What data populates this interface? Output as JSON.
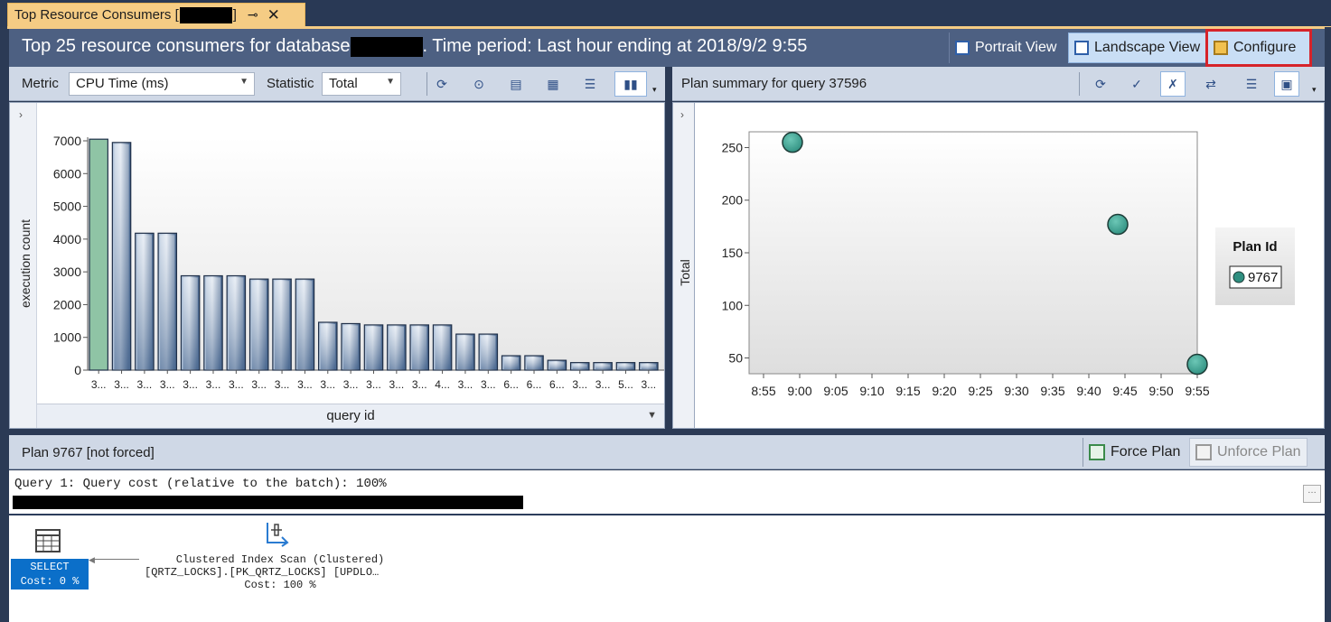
{
  "tab": {
    "title_prefix": "Top Resource Consumers [",
    "title_suffix": "]",
    "pin_glyph": "⊸",
    "close_glyph": "✕"
  },
  "header": {
    "title_prefix": "Top 25 resource consumers for database",
    "title_suffix": ". Time period: Last hour ending at 2018/9/2 9:55",
    "buttons": {
      "portrait": "Portrait View",
      "landscape": "Landscape View",
      "configure": "Configure"
    }
  },
  "left_toolbar": {
    "metric_label": "Metric",
    "metric_value": "CPU Time (ms)",
    "statistic_label": "Statistic",
    "statistic_value": "Total",
    "icons": [
      "refresh-icon",
      "track-query-icon",
      "view-query-text-icon",
      "grid-view-icon",
      "grid-additional-icon",
      "chart-view-icon"
    ]
  },
  "right_toolbar": {
    "title": "Plan summary for query 37596",
    "icons": [
      "refresh-icon",
      "force-plan-icon",
      "unforce-plan-icon",
      "compare-plans-icon",
      "grid-view-icon",
      "chart-view-icon"
    ]
  },
  "query_id_selector": {
    "label": "query id"
  },
  "plan_bar": {
    "label": "Plan 9767 [not forced]",
    "force_label": "Force Plan",
    "unforce_label": "Unforce Plan"
  },
  "showplan": {
    "query_line": "Query 1: Query cost (relative to the batch): 100%",
    "select_node": {
      "label": "SELECT",
      "cost": "Cost: 0 %"
    },
    "scan_node": {
      "line1": "Clustered Index Scan (Clustered)",
      "line2": "[QRTZ_LOCKS].[PK_QRTZ_LOCKS] [UPDLO…",
      "line3": "Cost: 100 %"
    }
  },
  "chart_data": [
    {
      "type": "bar",
      "ylabel": "execution count",
      "xlabel": "query id",
      "ylim": [
        0,
        7000
      ],
      "yticks": [
        0,
        1000,
        2000,
        3000,
        4000,
        5000,
        6000,
        7000
      ],
      "categories": [
        "3...",
        "3...",
        "3...",
        "3...",
        "3...",
        "3...",
        "3...",
        "3...",
        "3...",
        "3...",
        "3...",
        "3...",
        "3...",
        "3...",
        "3...",
        "4...",
        "3...",
        "3...",
        "6...",
        "6...",
        "6...",
        "3...",
        "3...",
        "5...",
        "3..."
      ],
      "values": [
        7050,
        6950,
        4180,
        4180,
        2880,
        2880,
        2880,
        2780,
        2780,
        2780,
        1460,
        1420,
        1380,
        1380,
        1380,
        1380,
        1100,
        1100,
        440,
        440,
        300,
        230,
        230,
        230,
        230
      ],
      "highlight_index": 0,
      "colors": {
        "bar": "#3a5a85",
        "highlight": "#8fc4a5"
      }
    },
    {
      "type": "scatter",
      "ylabel": "Total",
      "x_ticks": [
        "8:55",
        "9:00",
        "9:05",
        "9:10",
        "9:15",
        "9:20",
        "9:25",
        "9:30",
        "9:35",
        "9:40",
        "9:45",
        "9:50",
        "9:55"
      ],
      "yticks": [
        50,
        100,
        150,
        200,
        250
      ],
      "ylim": [
        35,
        265
      ],
      "xlim": [
        "8:55",
        "9:55"
      ],
      "series": [
        {
          "name": "9767",
          "points": [
            {
              "x": "8:59",
              "y": 255
            },
            {
              "x": "9:44",
              "y": 177
            },
            {
              "x": "9:55",
              "y": 44
            }
          ]
        }
      ],
      "legend_title": "Plan Id",
      "legend_position": "right",
      "colors": {
        "point": "#2f8f80"
      }
    }
  ]
}
